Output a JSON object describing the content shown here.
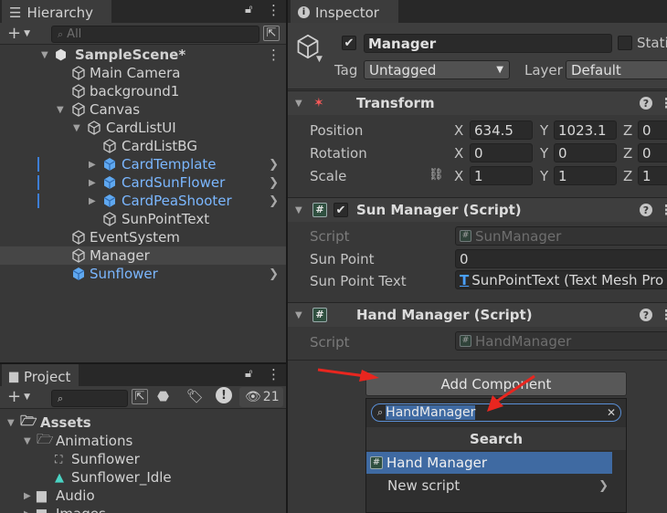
{
  "hierarchy": {
    "tab_label": "Hierarchy",
    "add_label": "+",
    "search_placeholder": "All",
    "scene_name": "SampleScene*",
    "items": [
      {
        "label": "Main Camera"
      },
      {
        "label": "background1"
      },
      {
        "label": "Canvas"
      },
      {
        "label": "CardListUI"
      },
      {
        "label": "CardListBG"
      },
      {
        "label": "CardTemplate"
      },
      {
        "label": "CardSunFlower"
      },
      {
        "label": "CardPeaShooter"
      },
      {
        "label": "SunPointText"
      },
      {
        "label": "EventSystem"
      },
      {
        "label": "Manager"
      },
      {
        "label": "Sunflower"
      }
    ]
  },
  "project": {
    "tab_label": "Project",
    "add_label": "+",
    "hidden_count": "21",
    "items": [
      {
        "label": "Assets"
      },
      {
        "label": "Animations"
      },
      {
        "label": "Sunflower"
      },
      {
        "label": "Sunflower_Idle"
      },
      {
        "label": "Audio"
      },
      {
        "label": "Images"
      }
    ]
  },
  "inspector": {
    "tab_label": "Inspector",
    "object_name": "Manager",
    "static_label": "Stati",
    "tag_label": "Tag",
    "tag_value": "Untagged",
    "layer_label": "Layer",
    "layer_value": "Default",
    "transform": {
      "title": "Transform",
      "position_label": "Position",
      "rotation_label": "Rotation",
      "scale_label": "Scale",
      "x_label": "X",
      "y_label": "Y",
      "z_label": "Z",
      "position": {
        "x": "634.5",
        "y": "1023.1",
        "z": "0"
      },
      "rotation": {
        "x": "0",
        "y": "0",
        "z": "0"
      },
      "scale": {
        "x": "1",
        "y": "1",
        "z": "1"
      }
    },
    "sun_manager": {
      "title": "Sun Manager (Script)",
      "script_label": "Script",
      "script_value": "SunManager",
      "sun_point_label": "Sun Point",
      "sun_point_value": "0",
      "sun_point_text_label": "Sun Point Text",
      "sun_point_text_value": "SunPointText (Text Mesh Pro"
    },
    "hand_manager": {
      "title": "Hand Manager (Script)",
      "script_label": "Script",
      "script_value": "HandManager"
    },
    "add_component_label": "Add Component",
    "popup": {
      "search_value": "HandManager",
      "header": "Search",
      "results": [
        {
          "label": "Hand Manager"
        },
        {
          "label": "New script"
        }
      ]
    }
  },
  "colors": {
    "accent": "#3d7ed6",
    "prefab_text": "#7bb7ff",
    "annotation_arrow": "#e8261f",
    "selection": "#3f6aa2"
  }
}
